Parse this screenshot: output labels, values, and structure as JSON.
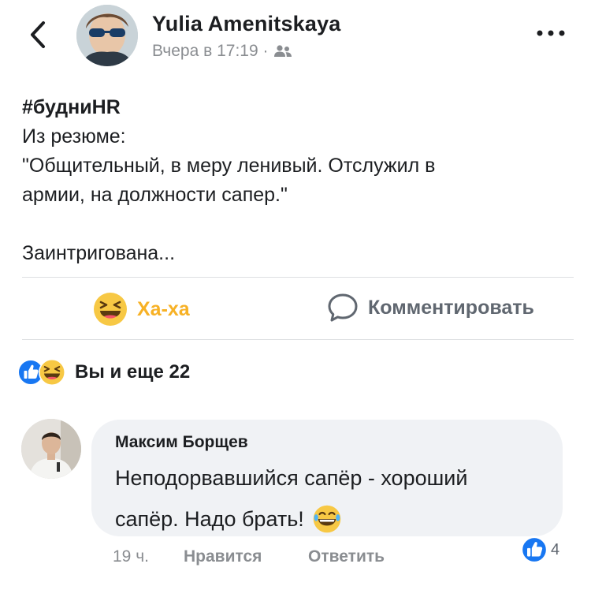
{
  "post": {
    "author": "Yulia Amenitskaya",
    "timestamp": "Вчера в 17:19 ·",
    "hashtag": "#будниHR",
    "lines": [
      "Из резюме:",
      "\"Общительный, в меру ленивый. Отслужил в",
      "армии, на должности сапер.\"",
      "Заинтригована..."
    ]
  },
  "actions": {
    "reaction_label": "Ха-ха",
    "comment_label": "Комментировать"
  },
  "reactions_summary": {
    "text": "Вы и еще 22"
  },
  "comment": {
    "author": "Максим Борщев",
    "text_line1": "Неподорвавшийся сапёр - хороший",
    "text_line2": "сапёр. Надо брать!",
    "time": "19 ч.",
    "like_label": "Нравится",
    "reply_label": "Ответить",
    "reactions_count": "4"
  },
  "colors": {
    "haha": "#f7b125",
    "like_blue": "#1877f2",
    "muted": "#8a8d91",
    "divider": "#dddfe2",
    "bubble": "#f0f2f5"
  },
  "icons": {
    "back": "chevron-left-icon",
    "more": "more-dots-icon",
    "audience": "friends-icon",
    "haha": "haha-emoji-icon",
    "comment": "comment-bubble-icon",
    "like": "like-thumb-icon"
  }
}
